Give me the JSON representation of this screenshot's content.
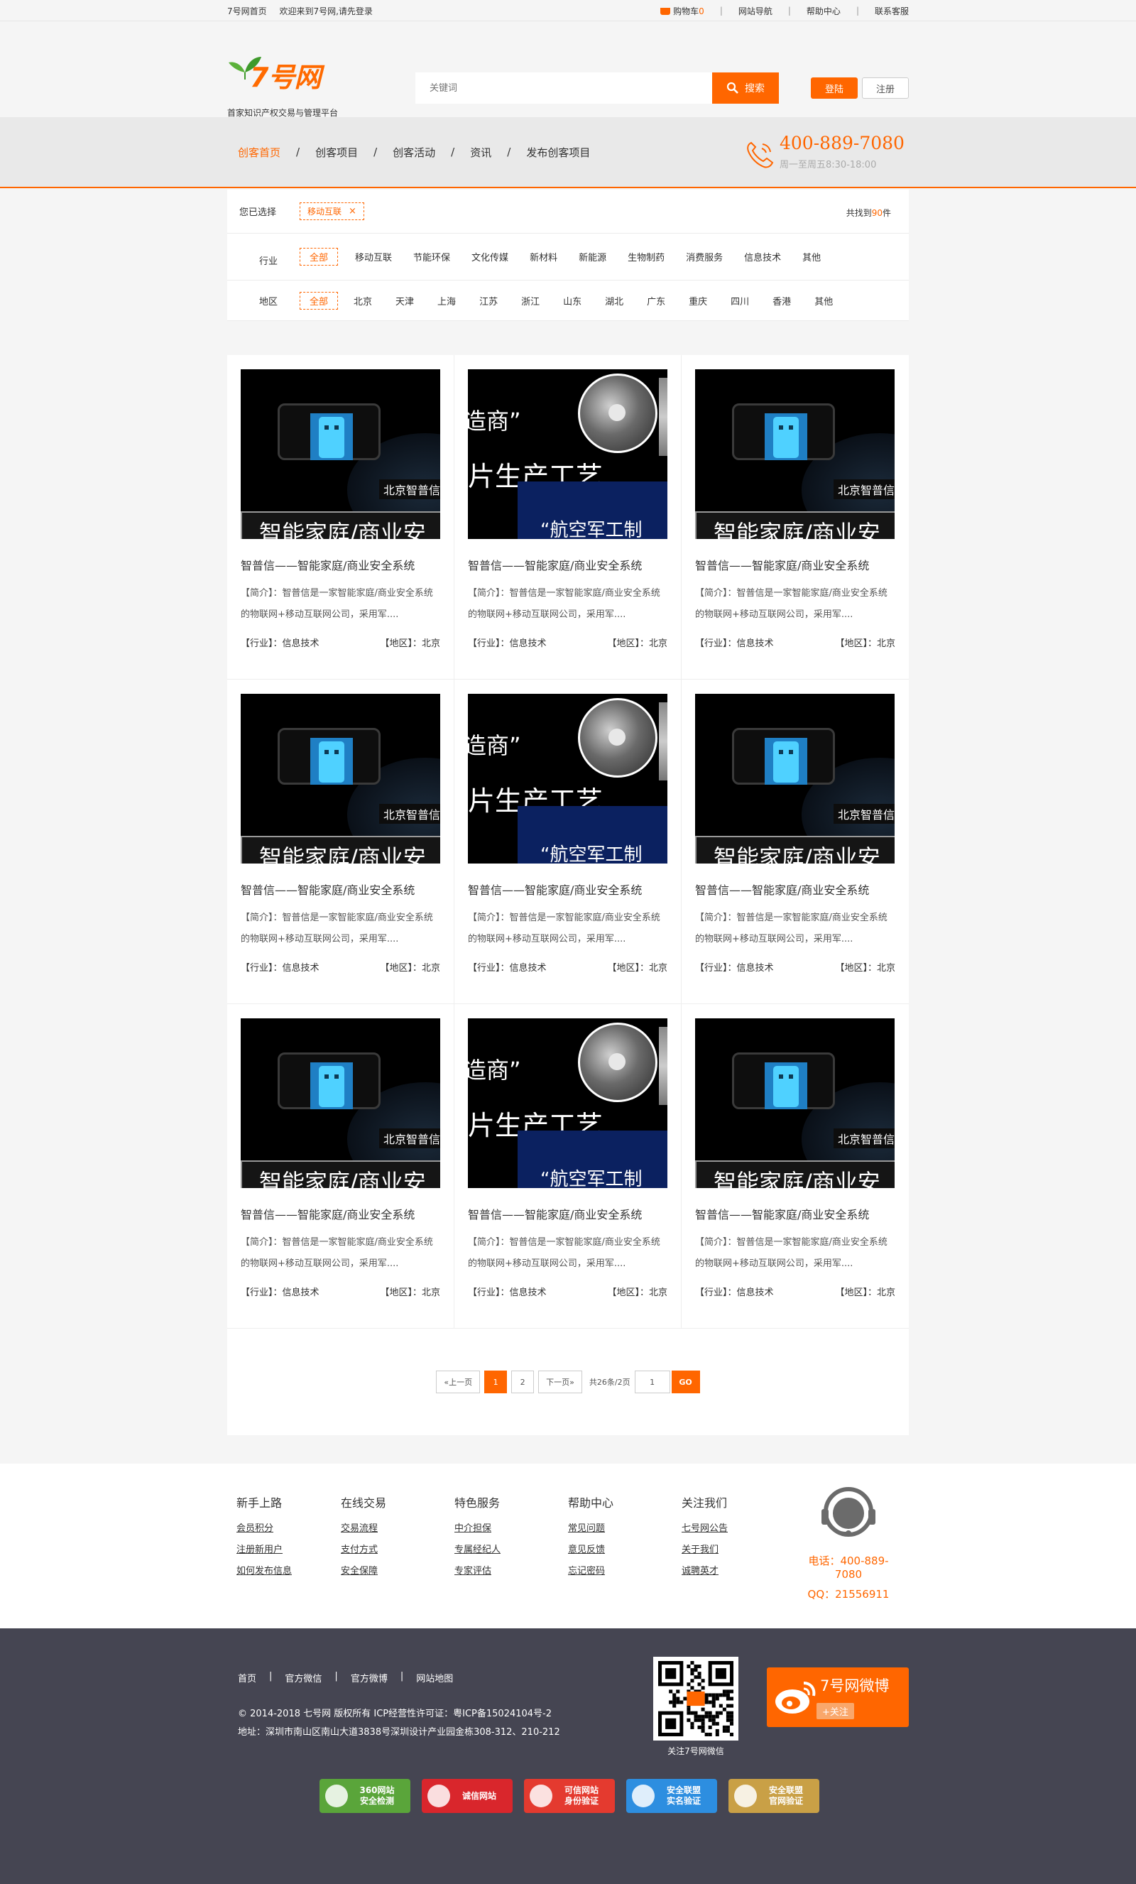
{
  "topbar": {
    "home": "7号网首页",
    "welcome": "欢迎来到7号网,请先登录",
    "cart_label": "购物车",
    "cart_count": "0",
    "links": [
      "网站导航",
      "帮助中心",
      "联系客服"
    ]
  },
  "header": {
    "logo_text": "7号网",
    "slogan": "首家知识产权交易与管理平台",
    "search_placeholder": "关键词",
    "search_button": "搜索",
    "login": "登陆",
    "register": "注册"
  },
  "nav": {
    "items": [
      "创客首页",
      "创客项目",
      "创客活动",
      "资讯",
      "发布创客项目"
    ],
    "active_index": 0,
    "hotline": "400-889-7080",
    "hours": "周一至周五8:30-18:00"
  },
  "filter": {
    "selected_label": "您已选择",
    "selected_tag": "移动互联",
    "selected_remove": "×",
    "found_prefix": "共找到",
    "found_count": "90",
    "found_suffix": "件",
    "industry_label": "行业",
    "industry_options": [
      "全部",
      "移动互联",
      "节能环保",
      "文化传媒",
      "新材料",
      "新能源",
      "生物制药",
      "消费服务",
      "信息技术",
      "其他"
    ],
    "region_label": "地区",
    "region_options": [
      "全部",
      "北京",
      "天津",
      "上海",
      "江苏",
      "浙江",
      "山东",
      "湖北",
      "广东",
      "重庆",
      "四川",
      "香港",
      "其他"
    ]
  },
  "card_images": {
    "a_brand": "北京智普信",
    "a_banner": "智能家庭/商业安",
    "b_quote": "造商”",
    "b_big": "片生产工艺",
    "b_sub": "“航空军工制"
  },
  "cards": [
    {
      "image": "a",
      "title": "智普信——智能家庭/商业安全系统",
      "desc": "【简介】：智普信是一家智能家庭/商业安全系统的物联网+移动互联网公司，采用军....",
      "industry": "【行业】：信息技术",
      "region": "【地区】：北京"
    },
    {
      "image": "b",
      "title": "智普信——智能家庭/商业安全系统",
      "desc": "【简介】：智普信是一家智能家庭/商业安全系统的物联网+移动互联网公司，采用军....",
      "industry": "【行业】：信息技术",
      "region": "【地区】：北京"
    },
    {
      "image": "a",
      "title": "智普信——智能家庭/商业安全系统",
      "desc": "【简介】：智普信是一家智能家庭/商业安全系统的物联网+移动互联网公司，采用军....",
      "industry": "【行业】：信息技术",
      "region": "【地区】：北京"
    },
    {
      "image": "a",
      "title": "智普信——智能家庭/商业安全系统",
      "desc": "【简介】：智普信是一家智能家庭/商业安全系统的物联网+移动互联网公司，采用军....",
      "industry": "【行业】：信息技术",
      "region": "【地区】：北京"
    },
    {
      "image": "b",
      "title": "智普信——智能家庭/商业安全系统",
      "desc": "【简介】：智普信是一家智能家庭/商业安全系统的物联网+移动互联网公司，采用军....",
      "industry": "【行业】：信息技术",
      "region": "【地区】：北京"
    },
    {
      "image": "a",
      "title": "智普信——智能家庭/商业安全系统",
      "desc": "【简介】：智普信是一家智能家庭/商业安全系统的物联网+移动互联网公司，采用军....",
      "industry": "【行业】：信息技术",
      "region": "【地区】：北京"
    },
    {
      "image": "a",
      "title": "智普信——智能家庭/商业安全系统",
      "desc": "【简介】：智普信是一家智能家庭/商业安全系统的物联网+移动互联网公司，采用军....",
      "industry": "【行业】：信息技术",
      "region": "【地区】：北京"
    },
    {
      "image": "b",
      "title": "智普信——智能家庭/商业安全系统",
      "desc": "【简介】：智普信是一家智能家庭/商业安全系统的物联网+移动互联网公司，采用军....",
      "industry": "【行业】：信息技术",
      "region": "【地区】：北京"
    },
    {
      "image": "a",
      "title": "智普信——智能家庭/商业安全系统",
      "desc": "【简介】：智普信是一家智能家庭/商业安全系统的物联网+移动互联网公司，采用军....",
      "industry": "【行业】：信息技术",
      "region": "【地区】：北京"
    }
  ],
  "pager": {
    "prev": "«上一页",
    "pages": [
      "1",
      "2"
    ],
    "current": "1",
    "next": "下一页»",
    "total": "共26条/2页",
    "input_value": "1",
    "go": "GO"
  },
  "help": {
    "columns": [
      {
        "title": "新手上路",
        "links": [
          "会员积分",
          "注册新用户",
          "如何发布信息"
        ]
      },
      {
        "title": "在线交易",
        "links": [
          "交易流程",
          "支付方式",
          "安全保障"
        ]
      },
      {
        "title": "特色服务",
        "links": [
          "中介担保",
          "专属经纪人",
          "专家评估"
        ]
      },
      {
        "title": "帮助中心",
        "links": [
          "常见问题",
          "意见反馈",
          "忘记密码"
        ]
      },
      {
        "title": "关注我们",
        "links": [
          "七号网公告",
          "关于我们",
          "诚聘英才"
        ]
      }
    ],
    "phone": "电话：400-889-7080",
    "qq": "QQ：21556911"
  },
  "bottom": {
    "links": [
      "首页",
      "官方微信",
      "官方微博",
      "网站地图"
    ],
    "copyright": "© 2014-2018 七号网 版权所有 ICP经营性许可证：粤ICP备15024104号-2",
    "address": "地址：深圳市南山区南山大道3838号深圳设计产业园金栋308-312、210-212",
    "qr_caption": "关注7号网微信",
    "weibo_title": "7号网微博",
    "weibo_follow": "+关注",
    "badges": [
      {
        "text": "360网站\n安全检测",
        "color": "#5aa53a"
      },
      {
        "text": "诚信网站",
        "color": "#d9262c"
      },
      {
        "text": "可信网站\n身份验证",
        "color": "#e43a2f"
      },
      {
        "text": "安全联盟\n实名验证",
        "color": "#2d8ee0"
      },
      {
        "text": "安全联盟\n官网验证",
        "color": "#c9a046"
      }
    ]
  },
  "colors": {
    "accent": "#ff6600",
    "footer_bg": "#454552"
  }
}
